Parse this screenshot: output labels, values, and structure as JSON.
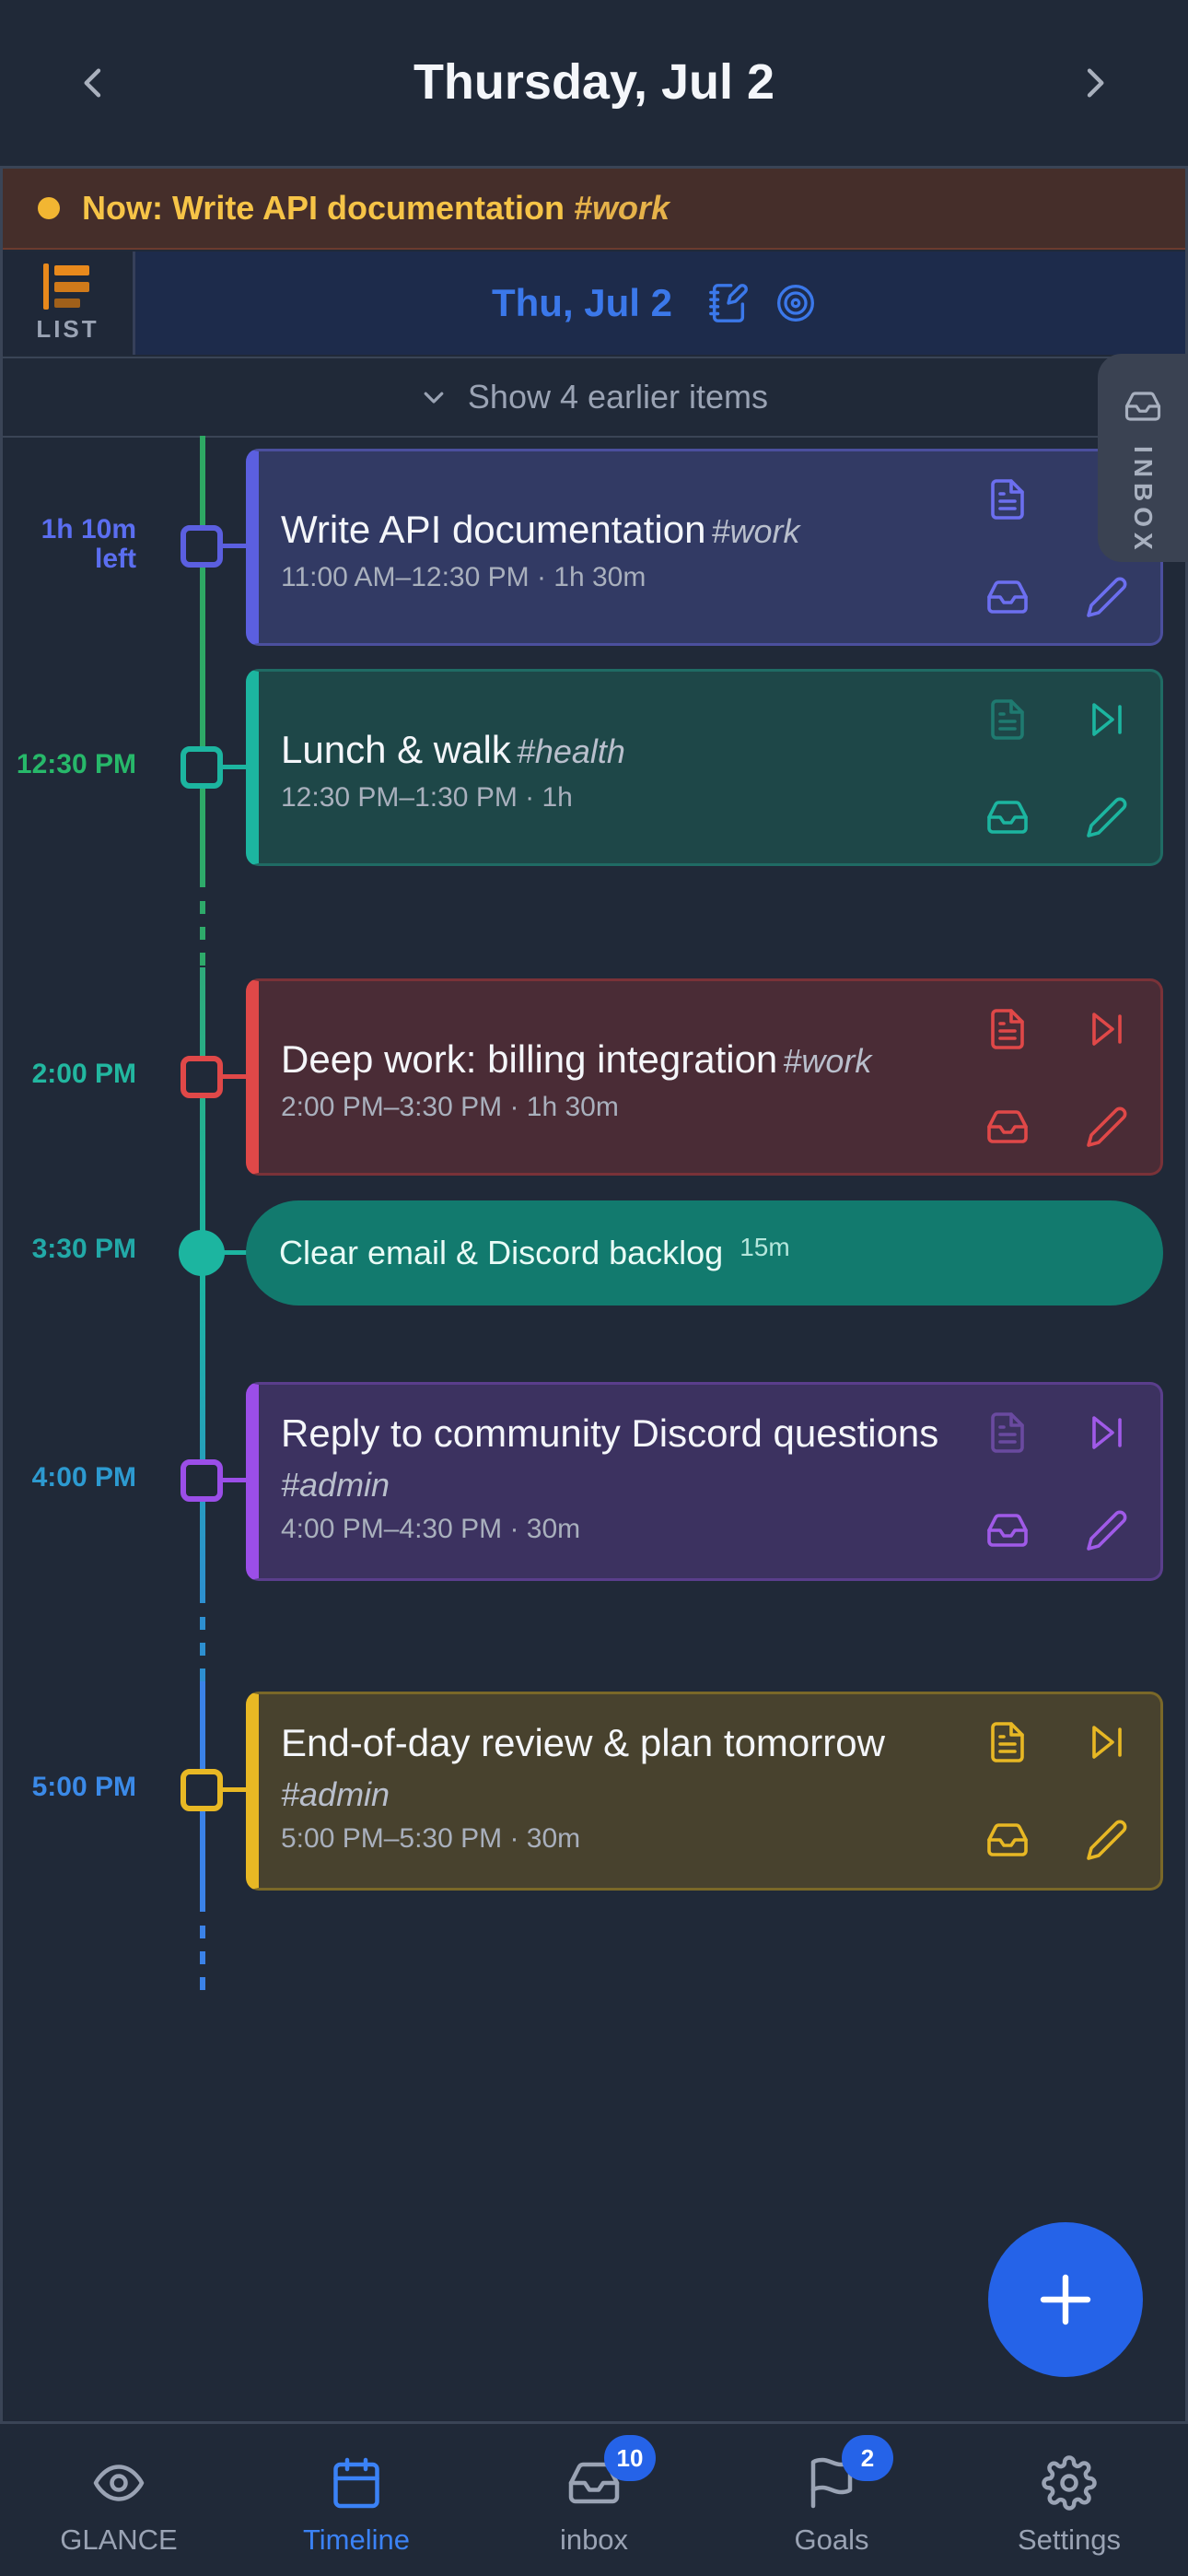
{
  "header": {
    "title": "Thursday, Jul 2"
  },
  "now_banner": {
    "prefix": "Now: Write API documentation",
    "tag": "#work"
  },
  "list_button": {
    "label": "LIST"
  },
  "date_band": {
    "date": "Thu, Jul 2"
  },
  "earlier": {
    "label": "Show 4 earlier items"
  },
  "inbox_tab": {
    "label": "INBOX"
  },
  "timeline": {
    "labels": {
      "l1": "1h 10m",
      "l1b": "left",
      "l2": "12:30 PM",
      "l3": "2:00 PM",
      "l4": "3:30 PM",
      "l5": "4:00 PM",
      "l6": "5:00 PM"
    },
    "cards": [
      {
        "title": "Write API documentation",
        "tag": "#work",
        "meta": "11:00 AM–12:30 PM · 1h 30m",
        "accent": "#5b5fe0"
      },
      {
        "title": "Lunch & walk",
        "tag": "#health",
        "meta": "12:30 PM–1:30 PM · 1h",
        "accent": "#1cb5a0"
      },
      {
        "title": "Deep work: billing integration",
        "tag": "#work",
        "meta": "2:00 PM–3:30 PM · 1h 30m",
        "accent": "#e04848"
      },
      {
        "title": "Reply to community Discord questions",
        "tag": "#admin",
        "meta": "4:00 PM–4:30 PM · 30m",
        "accent": "#9b4ee8"
      },
      {
        "title": "End-of-day review & plan tomorrow",
        "tag": "#admin",
        "meta": "5:00 PM–5:30 PM · 30m",
        "accent": "#e8b824"
      }
    ],
    "quick_item": {
      "title": "Clear email & Discord backlog",
      "duration": "15m"
    }
  },
  "tabbar": {
    "tabs": [
      {
        "label": "GLANCE",
        "icon": "eye-icon"
      },
      {
        "label": "Timeline",
        "icon": "calendar-icon"
      },
      {
        "label": "inbox",
        "icon": "inbox-icon",
        "badge": "10"
      },
      {
        "label": "Goals",
        "icon": "flag-icon",
        "badge": "2"
      },
      {
        "label": "Settings",
        "icon": "gear-icon"
      }
    ],
    "active": "Timeline"
  }
}
